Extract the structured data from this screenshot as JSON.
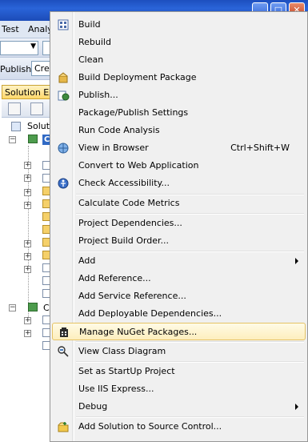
{
  "menubar": {
    "items": [
      "Test",
      "Analy"
    ]
  },
  "toolbar2": {
    "publish_label": "Publish:",
    "publish_combo_value": "Crea"
  },
  "solution_explorer": {
    "tab_label": "Solution Exp",
    "root_label": "Soluti",
    "selected_node_initial": "C",
    "second_project_initial": "C"
  },
  "context_menu": {
    "items": [
      {
        "label": "Build",
        "icon": "build-icon"
      },
      {
        "label": "Rebuild"
      },
      {
        "label": "Clean"
      },
      {
        "label": "Build Deployment Package",
        "icon": "deployment-package-icon"
      },
      {
        "label": "Publish...",
        "icon": "publish-icon"
      },
      {
        "label": "Package/Publish Settings"
      },
      {
        "label": "Run Code Analysis"
      },
      {
        "label": "View in Browser",
        "icon": "browser-icon",
        "shortcut": "Ctrl+Shift+W"
      },
      {
        "label": "Convert to Web Application"
      },
      {
        "label": "Check Accessibility...",
        "icon": "accessibility-icon"
      },
      {
        "label": "Calculate Code Metrics"
      },
      {
        "label": "Project Dependencies..."
      },
      {
        "label": "Project Build Order..."
      },
      {
        "label": "Add",
        "submenu": true
      },
      {
        "label": "Add Reference..."
      },
      {
        "label": "Add Service Reference..."
      },
      {
        "label": "Add Deployable Dependencies..."
      },
      {
        "label": "Manage NuGet Packages...",
        "icon": "nuget-icon",
        "highlighted": true
      },
      {
        "label": "View Class Diagram",
        "icon": "class-diagram-icon"
      },
      {
        "label": "Set as StartUp Project"
      },
      {
        "label": "Use IIS Express..."
      },
      {
        "label": "Debug",
        "submenu": true
      },
      {
        "label": "Add Solution to Source Control...",
        "icon": "source-control-icon"
      }
    ]
  },
  "colors": {
    "highlight_bg": "#fdeebd",
    "highlight_border": "#e5c365",
    "titlebar": "#2a64d8",
    "selection": "#316ac5"
  }
}
